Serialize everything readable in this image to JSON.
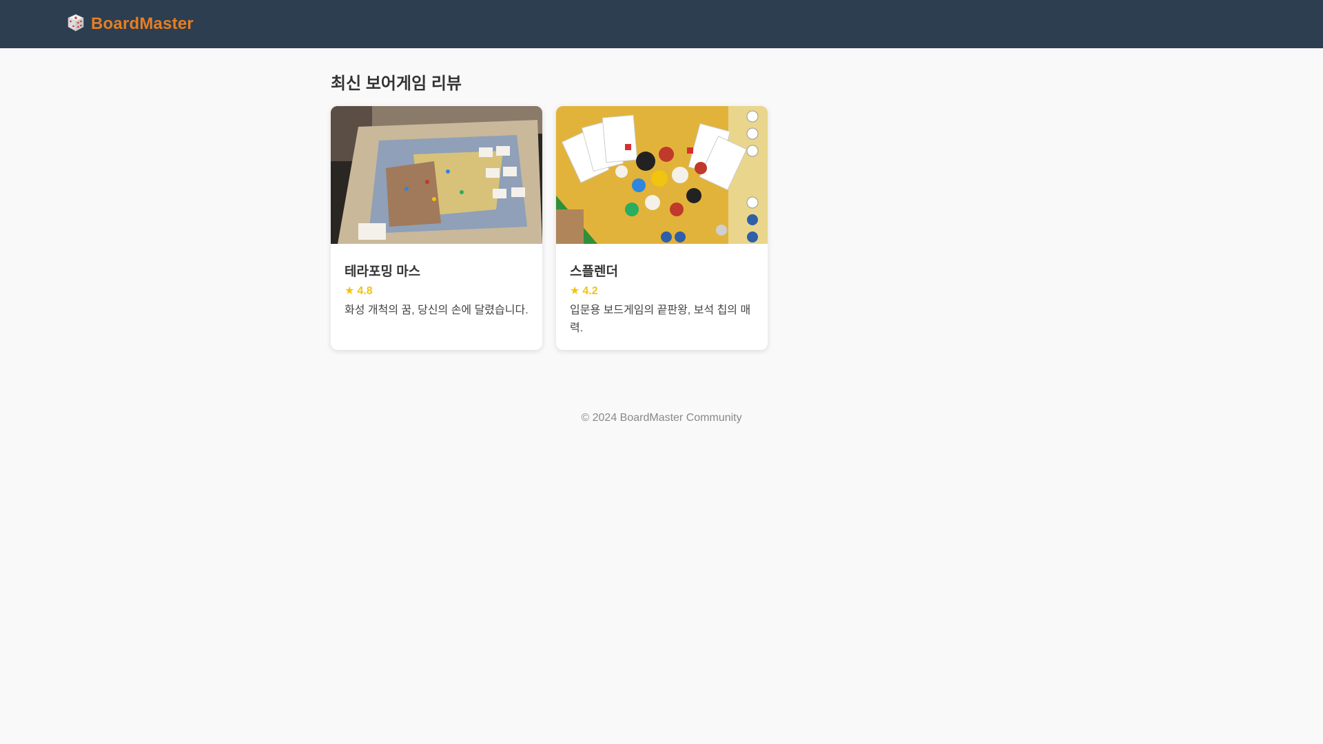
{
  "header": {
    "logo_icon": "dice-icon",
    "brand_name": "BoardMaster",
    "brand_color": "#e67e22",
    "bar_color": "#2c3e50"
  },
  "main": {
    "section_title": "최신 보어게임 리뷰",
    "reviews": [
      {
        "image": "board-game-map-photo",
        "title": "테라포밍 마스",
        "rating_icon": "star-icon",
        "rating": "4.8",
        "description": "화성 개척의 꿈, 당신의 손에 달렸습니다."
      },
      {
        "image": "cards-and-pawns-photo",
        "title": "스플렌더",
        "rating_icon": "star-icon",
        "rating": "4.2",
        "description": "입문용 보드게임의 끝판왕, 보석 칩의 매력."
      }
    ],
    "rating_color": "#f1c40f"
  },
  "footer": {
    "text": "© 2024 BoardMaster Community"
  }
}
